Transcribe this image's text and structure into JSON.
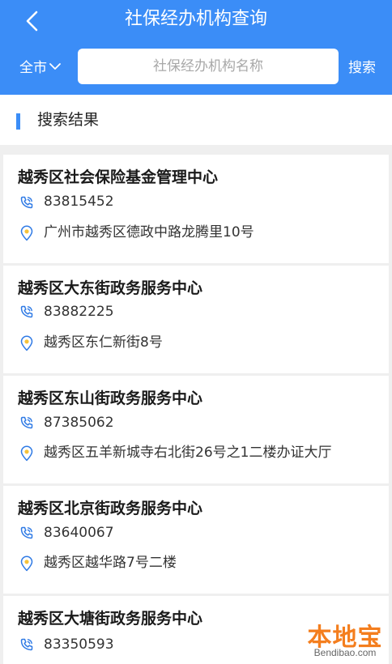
{
  "header": {
    "title": "社保经办机构查询",
    "city_label": "全市",
    "search_placeholder": "社保经办机构名称",
    "search_button": "搜索"
  },
  "section": {
    "title": "搜索结果"
  },
  "results": [
    {
      "name": "越秀区社会保险基金管理中心",
      "phone": "83815452",
      "address": "广州市越秀区德政中路龙腾里10号"
    },
    {
      "name": "越秀区大东街政务服务中心",
      "phone": "83882225",
      "address": "越秀区东仁新街8号"
    },
    {
      "name": "越秀区东山街政务服务中心",
      "phone": "87385062",
      "address": "越秀区五羊新城寺右北街26号之1二楼办证大厅"
    },
    {
      "name": "越秀区北京街政务服务中心",
      "phone": "83640067",
      "address": "越秀区越华路7号二楼"
    },
    {
      "name": "越秀区大塘街政务服务中心",
      "phone": "83350593"
    }
  ],
  "watermark": {
    "brand": "本地宝",
    "site": "Bendibao.com"
  },
  "colors": {
    "primary": "#3b8df7",
    "icon_blue": "#2f7ae5",
    "pin_yellow": "#f6c33a"
  },
  "icons": {
    "back": "chevron-left-icon",
    "dropdown": "chevron-down-icon",
    "phone": "phone-icon",
    "location": "location-pin-icon"
  }
}
